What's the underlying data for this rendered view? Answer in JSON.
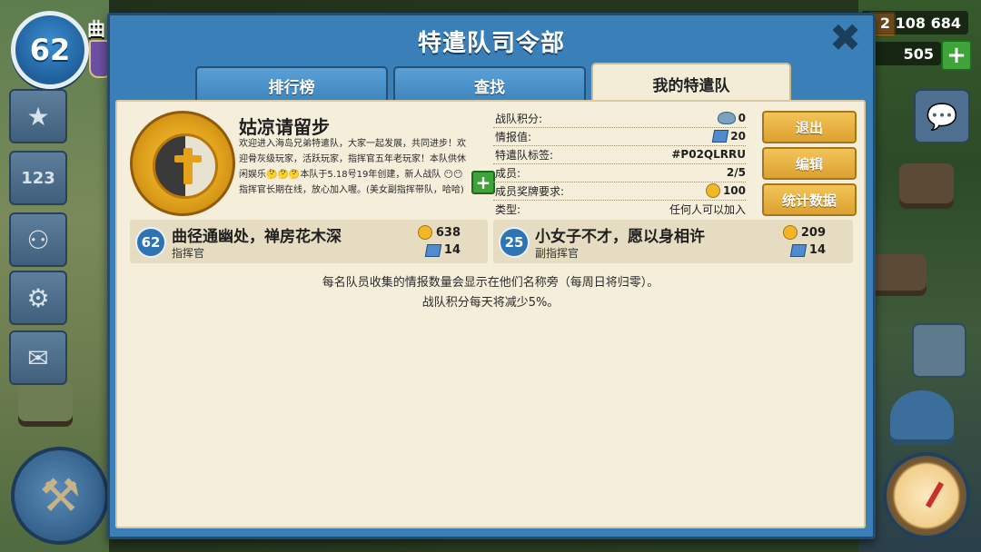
{
  "hud": {
    "player_level": "62",
    "player_name": "曲",
    "gold": "2 108 684",
    "diamonds": "505",
    "plus": "+"
  },
  "dialog": {
    "title": "特遣队司令部",
    "close": "✖",
    "tabs": [
      {
        "label": "排行榜"
      },
      {
        "label": "查找"
      },
      {
        "label": "我的特遣队"
      }
    ]
  },
  "squad": {
    "name": "姑凉请留步",
    "description": "欢迎进入海岛兄弟特遣队，大家一起发展，共同进步！欢迎骨灰级玩家，活跃玩家，指挥官五年老玩家！本队供休闲娱乐🤔🤔🤔本队于5.18号19年创建，新人战队 😶😶指挥官长期在线，放心加入喔。(美女副指挥带队，哈哈)",
    "info": [
      {
        "label": "战队积分:",
        "value": "0",
        "icon": "wing-icon"
      },
      {
        "label": "情报值:",
        "value": "20",
        "icon": "intel-icon"
      },
      {
        "label": "特遣队标签:",
        "value": "#P02QLRRU",
        "icon": ""
      },
      {
        "label": "成员:",
        "value": "2/5",
        "icon": ""
      },
      {
        "label": "成员奖牌要求:",
        "value": "100",
        "icon": "medal-icon"
      },
      {
        "label": "类型:",
        "value": "任何人可以加入",
        "icon": ""
      }
    ],
    "actions": {
      "leave": "退出",
      "edit": "编辑",
      "stats": "统计数据"
    }
  },
  "members": [
    {
      "level": "62",
      "name": "曲径通幽处，禅房花木深",
      "role": "指挥官",
      "medals": "638",
      "intel": "14"
    },
    {
      "level": "25",
      "name": "小女子不才，愿以身相许",
      "role": "副指挥官",
      "medals": "209",
      "intel": "14"
    }
  ],
  "notes": {
    "line1": "每名队员收集的情报数量会显示在他们名称旁（每周日将归零）。",
    "line2": "战队积分每天将减少5%。"
  }
}
